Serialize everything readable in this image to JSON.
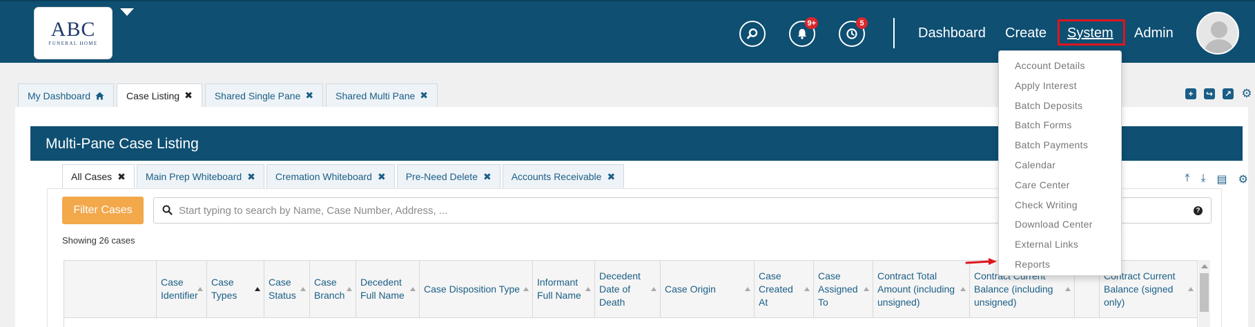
{
  "logo": {
    "main": "ABC",
    "sub": "FUNERAL HOME"
  },
  "topnav": {
    "notifications_badge": "9+",
    "history_badge": "5",
    "links": [
      "Dashboard",
      "Create",
      "System",
      "Admin"
    ],
    "active": "System"
  },
  "main_tabs": [
    {
      "label": "My Dashboard",
      "icon": "home-icon"
    },
    {
      "label": "Case Listing",
      "active": true
    },
    {
      "label": "Shared Single Pane"
    },
    {
      "label": "Shared Multi Pane"
    }
  ],
  "panel": {
    "title": "Multi-Pane Case Listing",
    "sub_tabs": [
      "All Cases",
      "Main Prep Whiteboard",
      "Cremation Whiteboard",
      "Pre-Need Delete",
      "Accounts Receivable"
    ],
    "filter_label": "Filter Cases",
    "search_placeholder": "Start typing to search by Name, Case Number, Address, ...",
    "showing": "Showing 26 cases"
  },
  "table": {
    "columns": [
      "",
      "Case Identifier",
      "Case Types",
      "Case Status",
      "Case Branch",
      "Decedent Full Name",
      "Case Disposition Type",
      "Informant Full Name",
      "Decedent Date of Death",
      "Case Origin",
      "Case Created At",
      "Case Assigned To",
      "Contract Total Amount (including unsigned)",
      "Contract Current Balance (including unsigned)",
      "",
      "Contract Current Balance (signed only)"
    ]
  },
  "system_menu": [
    "Account Details",
    "Apply Interest",
    "Batch Deposits",
    "Batch Forms",
    "Batch Payments",
    "Calendar",
    "Care Center",
    "Check Writing",
    "Download Center",
    "External Links",
    "Reports"
  ],
  "colors": {
    "navbar": "#0e4f72",
    "accent": "#f2a84b",
    "link": "#1a5e86",
    "highlight": "#e0141e"
  }
}
